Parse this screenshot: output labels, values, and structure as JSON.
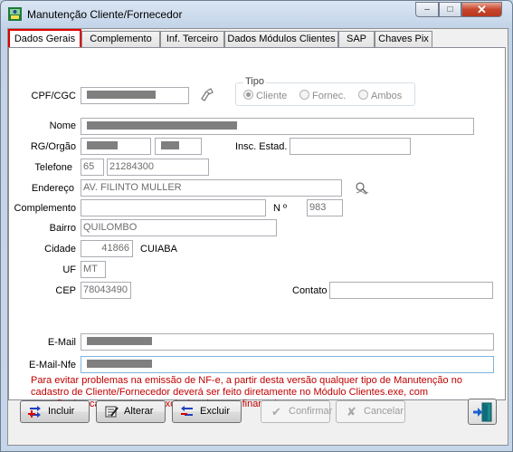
{
  "window": {
    "title": "Manutenção Cliente/Fornecedor",
    "min": "–",
    "max": "□",
    "close": "✕"
  },
  "tabs": [
    {
      "label": "Dados Gerais",
      "active": true
    },
    {
      "label": "Complemento"
    },
    {
      "label": "Inf. Terceiro"
    },
    {
      "label": "Dados Módulos Clientes"
    },
    {
      "label": "SAP"
    },
    {
      "label": "Chaves Pix"
    }
  ],
  "form": {
    "cpf_label": "CPF/CGC",
    "tipo": {
      "label": "Tipo",
      "options": [
        "Cliente",
        "Fornec.",
        "Ambos"
      ],
      "selected": "Cliente"
    },
    "nome_label": "Nome",
    "rg_label": "RG/Orgão",
    "insc_label": "Insc. Estad.",
    "telefone_label": "Telefone",
    "telefone_ddd": "65",
    "telefone_num": "21284300",
    "endereco_label": "Endereço",
    "endereco_value": "AV. FILINTO MULLER",
    "complemento_label": "Complemento",
    "numero_label": "N º",
    "numero_value": "983",
    "bairro_label": "Bairro",
    "bairro_value": "QUILOMBO",
    "cidade_label": "Cidade",
    "cidade_code": "41866",
    "cidade_name": "CUIABA",
    "uf_label": "UF",
    "uf_value": "MT",
    "cep_label": "CEP",
    "cep_value": "78043490",
    "contato_label": "Contato",
    "email_label": "E-Mail",
    "emailnfe_label": "E-Mail-Nfe"
  },
  "warning": [
    "Para evitar problemas na emissão de NF-e, a partir desta versão qualquer tipo de Manutenção no",
    "cadastro de Cliente/Fornecedor deverá ser feito diretamente no Módulo Clientes.exe, com",
    "exceção dos campos de uso exclusivo do setor financeiro."
  ],
  "buttons": {
    "incluir": "Incluir",
    "alterar": "Alterar",
    "excluir": "Excluir",
    "confirmar": "Confirmar",
    "cancelar": "Cancelar"
  },
  "colors": {
    "warning": "#c00000",
    "active_tab_border": "#e00000"
  }
}
